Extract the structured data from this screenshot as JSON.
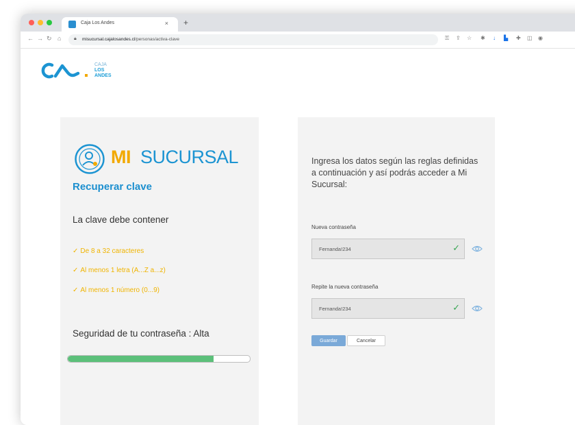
{
  "browser": {
    "tab_title": "Caja Los Andes",
    "tab_close": "×",
    "new_tab": "+",
    "url_host": "misucursal.cajalosandes.cl",
    "url_path": "/personas/activa-clave"
  },
  "logo": {
    "line1": "CAJA",
    "line2": "LOS",
    "line3": "ANDES"
  },
  "left_panel": {
    "brand_mi": "MI",
    "brand_sucursal": "SUCURSAL",
    "heading": "Recuperar clave",
    "rules_title": "La clave debe contener",
    "rules": [
      "De 8 a 32 caracteres",
      "Al menos 1 letra (A...Z a...z)",
      "Al menos 1 número (0...9)"
    ],
    "strength_text": "Seguridad de tu contraseña : Alta",
    "strength_fraction": 0.8
  },
  "right_panel": {
    "intro": "Ingresa los datos según las reglas definidas a continuación y así podrás acceder a Mi Sucursal:",
    "new_password_label": "Nueva contraseña",
    "new_password_value": "Fernanda!234",
    "repeat_password_label": "Repite la nueva contraseña",
    "repeat_password_value": "Fernanda!234",
    "save_label": "Guardar",
    "cancel_label": "Cancelar"
  },
  "colors": {
    "brand_blue": "#1c94d2",
    "brand_yellow": "#f2a900",
    "strength_green": "#5cc07a"
  }
}
